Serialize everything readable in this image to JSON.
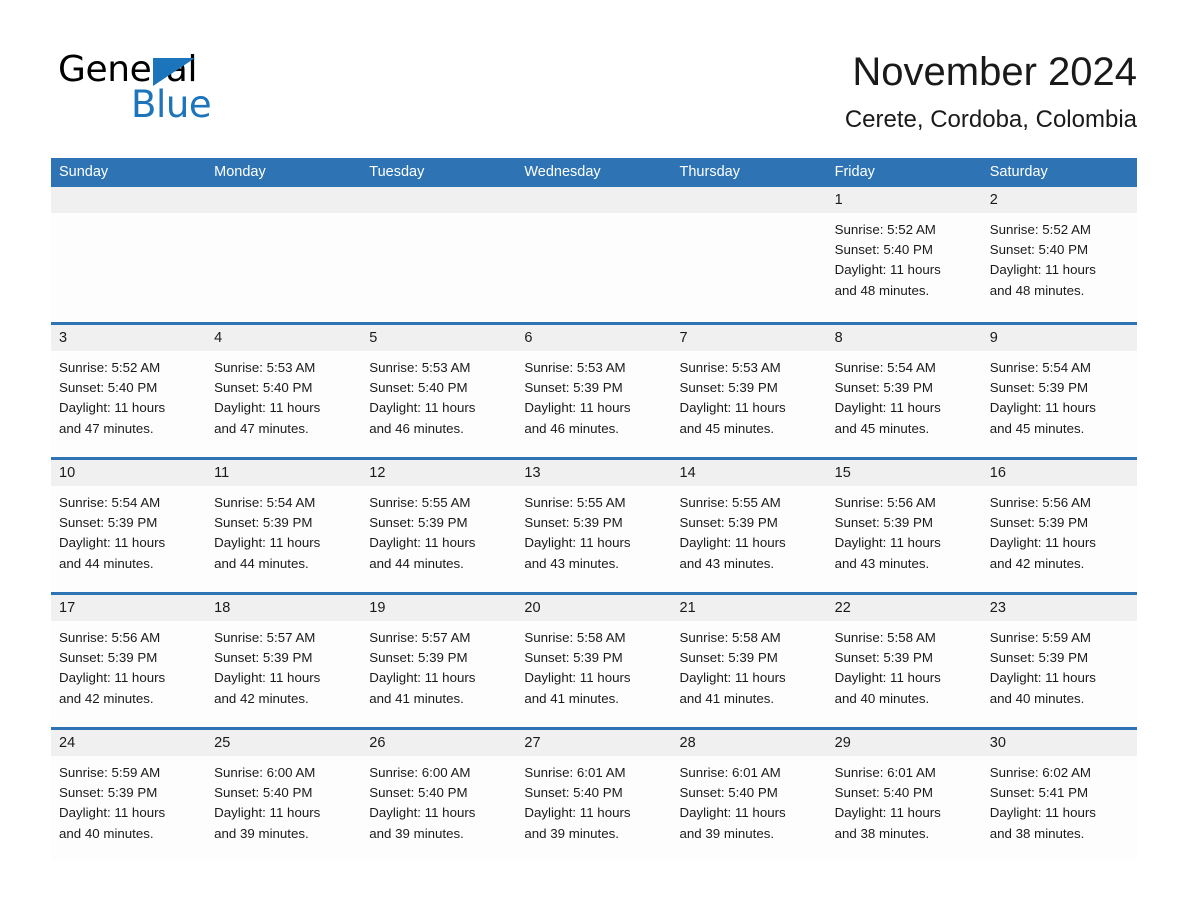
{
  "logo": {
    "word_one": "General",
    "word_two": "Blue",
    "triangle_color": "#1c74bb",
    "icon": "triangle-icon"
  },
  "header": {
    "month_title": "November 2024",
    "location": "Cerete, Cordoba, Colombia"
  },
  "theme": {
    "header_blue": "#2e74b5",
    "day_number_bg": "#f0f0f0",
    "cell_bg": "#fdfdfd",
    "text_color": "#1a1a1a"
  },
  "weekdays": [
    "Sunday",
    "Monday",
    "Tuesday",
    "Wednesday",
    "Thursday",
    "Friday",
    "Saturday"
  ],
  "weeks": [
    [
      {
        "day": "",
        "sunrise": "",
        "sunset": "",
        "daylight_line1": "",
        "daylight_line2": ""
      },
      {
        "day": "",
        "sunrise": "",
        "sunset": "",
        "daylight_line1": "",
        "daylight_line2": ""
      },
      {
        "day": "",
        "sunrise": "",
        "sunset": "",
        "daylight_line1": "",
        "daylight_line2": ""
      },
      {
        "day": "",
        "sunrise": "",
        "sunset": "",
        "daylight_line1": "",
        "daylight_line2": ""
      },
      {
        "day": "",
        "sunrise": "",
        "sunset": "",
        "daylight_line1": "",
        "daylight_line2": ""
      },
      {
        "day": "1",
        "sunrise": "Sunrise: 5:52 AM",
        "sunset": "Sunset: 5:40 PM",
        "daylight_line1": "Daylight: 11 hours",
        "daylight_line2": "and 48 minutes."
      },
      {
        "day": "2",
        "sunrise": "Sunrise: 5:52 AM",
        "sunset": "Sunset: 5:40 PM",
        "daylight_line1": "Daylight: 11 hours",
        "daylight_line2": "and 48 minutes."
      }
    ],
    [
      {
        "day": "3",
        "sunrise": "Sunrise: 5:52 AM",
        "sunset": "Sunset: 5:40 PM",
        "daylight_line1": "Daylight: 11 hours",
        "daylight_line2": "and 47 minutes."
      },
      {
        "day": "4",
        "sunrise": "Sunrise: 5:53 AM",
        "sunset": "Sunset: 5:40 PM",
        "daylight_line1": "Daylight: 11 hours",
        "daylight_line2": "and 47 minutes."
      },
      {
        "day": "5",
        "sunrise": "Sunrise: 5:53 AM",
        "sunset": "Sunset: 5:40 PM",
        "daylight_line1": "Daylight: 11 hours",
        "daylight_line2": "and 46 minutes."
      },
      {
        "day": "6",
        "sunrise": "Sunrise: 5:53 AM",
        "sunset": "Sunset: 5:39 PM",
        "daylight_line1": "Daylight: 11 hours",
        "daylight_line2": "and 46 minutes."
      },
      {
        "day": "7",
        "sunrise": "Sunrise: 5:53 AM",
        "sunset": "Sunset: 5:39 PM",
        "daylight_line1": "Daylight: 11 hours",
        "daylight_line2": "and 45 minutes."
      },
      {
        "day": "8",
        "sunrise": "Sunrise: 5:54 AM",
        "sunset": "Sunset: 5:39 PM",
        "daylight_line1": "Daylight: 11 hours",
        "daylight_line2": "and 45 minutes."
      },
      {
        "day": "9",
        "sunrise": "Sunrise: 5:54 AM",
        "sunset": "Sunset: 5:39 PM",
        "daylight_line1": "Daylight: 11 hours",
        "daylight_line2": "and 45 minutes."
      }
    ],
    [
      {
        "day": "10",
        "sunrise": "Sunrise: 5:54 AM",
        "sunset": "Sunset: 5:39 PM",
        "daylight_line1": "Daylight: 11 hours",
        "daylight_line2": "and 44 minutes."
      },
      {
        "day": "11",
        "sunrise": "Sunrise: 5:54 AM",
        "sunset": "Sunset: 5:39 PM",
        "daylight_line1": "Daylight: 11 hours",
        "daylight_line2": "and 44 minutes."
      },
      {
        "day": "12",
        "sunrise": "Sunrise: 5:55 AM",
        "sunset": "Sunset: 5:39 PM",
        "daylight_line1": "Daylight: 11 hours",
        "daylight_line2": "and 44 minutes."
      },
      {
        "day": "13",
        "sunrise": "Sunrise: 5:55 AM",
        "sunset": "Sunset: 5:39 PM",
        "daylight_line1": "Daylight: 11 hours",
        "daylight_line2": "and 43 minutes."
      },
      {
        "day": "14",
        "sunrise": "Sunrise: 5:55 AM",
        "sunset": "Sunset: 5:39 PM",
        "daylight_line1": "Daylight: 11 hours",
        "daylight_line2": "and 43 minutes."
      },
      {
        "day": "15",
        "sunrise": "Sunrise: 5:56 AM",
        "sunset": "Sunset: 5:39 PM",
        "daylight_line1": "Daylight: 11 hours",
        "daylight_line2": "and 43 minutes."
      },
      {
        "day": "16",
        "sunrise": "Sunrise: 5:56 AM",
        "sunset": "Sunset: 5:39 PM",
        "daylight_line1": "Daylight: 11 hours",
        "daylight_line2": "and 42 minutes."
      }
    ],
    [
      {
        "day": "17",
        "sunrise": "Sunrise: 5:56 AM",
        "sunset": "Sunset: 5:39 PM",
        "daylight_line1": "Daylight: 11 hours",
        "daylight_line2": "and 42 minutes."
      },
      {
        "day": "18",
        "sunrise": "Sunrise: 5:57 AM",
        "sunset": "Sunset: 5:39 PM",
        "daylight_line1": "Daylight: 11 hours",
        "daylight_line2": "and 42 minutes."
      },
      {
        "day": "19",
        "sunrise": "Sunrise: 5:57 AM",
        "sunset": "Sunset: 5:39 PM",
        "daylight_line1": "Daylight: 11 hours",
        "daylight_line2": "and 41 minutes."
      },
      {
        "day": "20",
        "sunrise": "Sunrise: 5:58 AM",
        "sunset": "Sunset: 5:39 PM",
        "daylight_line1": "Daylight: 11 hours",
        "daylight_line2": "and 41 minutes."
      },
      {
        "day": "21",
        "sunrise": "Sunrise: 5:58 AM",
        "sunset": "Sunset: 5:39 PM",
        "daylight_line1": "Daylight: 11 hours",
        "daylight_line2": "and 41 minutes."
      },
      {
        "day": "22",
        "sunrise": "Sunrise: 5:58 AM",
        "sunset": "Sunset: 5:39 PM",
        "daylight_line1": "Daylight: 11 hours",
        "daylight_line2": "and 40 minutes."
      },
      {
        "day": "23",
        "sunrise": "Sunrise: 5:59 AM",
        "sunset": "Sunset: 5:39 PM",
        "daylight_line1": "Daylight: 11 hours",
        "daylight_line2": "and 40 minutes."
      }
    ],
    [
      {
        "day": "24",
        "sunrise": "Sunrise: 5:59 AM",
        "sunset": "Sunset: 5:39 PM",
        "daylight_line1": "Daylight: 11 hours",
        "daylight_line2": "and 40 minutes."
      },
      {
        "day": "25",
        "sunrise": "Sunrise: 6:00 AM",
        "sunset": "Sunset: 5:40 PM",
        "daylight_line1": "Daylight: 11 hours",
        "daylight_line2": "and 39 minutes."
      },
      {
        "day": "26",
        "sunrise": "Sunrise: 6:00 AM",
        "sunset": "Sunset: 5:40 PM",
        "daylight_line1": "Daylight: 11 hours",
        "daylight_line2": "and 39 minutes."
      },
      {
        "day": "27",
        "sunrise": "Sunrise: 6:01 AM",
        "sunset": "Sunset: 5:40 PM",
        "daylight_line1": "Daylight: 11 hours",
        "daylight_line2": "and 39 minutes."
      },
      {
        "day": "28",
        "sunrise": "Sunrise: 6:01 AM",
        "sunset": "Sunset: 5:40 PM",
        "daylight_line1": "Daylight: 11 hours",
        "daylight_line2": "and 39 minutes."
      },
      {
        "day": "29",
        "sunrise": "Sunrise: 6:01 AM",
        "sunset": "Sunset: 5:40 PM",
        "daylight_line1": "Daylight: 11 hours",
        "daylight_line2": "and 38 minutes."
      },
      {
        "day": "30",
        "sunrise": "Sunrise: 6:02 AM",
        "sunset": "Sunset: 5:41 PM",
        "daylight_line1": "Daylight: 11 hours",
        "daylight_line2": "and 38 minutes."
      }
    ]
  ]
}
